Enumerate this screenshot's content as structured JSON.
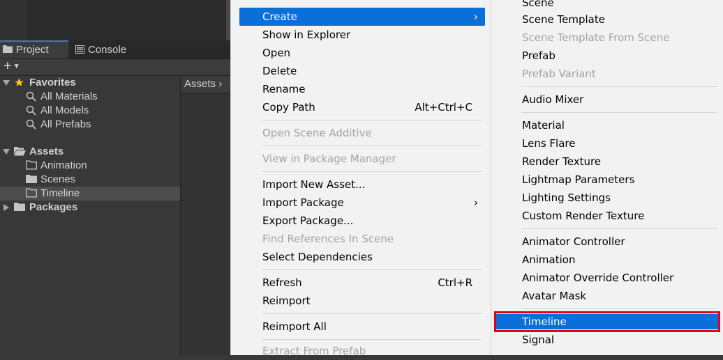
{
  "tabs": {
    "project": "Project",
    "console": "Console"
  },
  "toolbar": {
    "add_label": "+"
  },
  "tree": {
    "favorites": "Favorites",
    "all_materials": "All Materials",
    "all_models": "All Models",
    "all_prefabs": "All Prefabs",
    "assets": "Assets",
    "animation": "Animation",
    "scenes": "Scenes",
    "timeline": "Timeline",
    "packages": "Packages"
  },
  "breadcrumb": {
    "root": "Assets",
    "sep": "›"
  },
  "context_menu": {
    "create": "Create",
    "show_in_explorer": "Show in Explorer",
    "open": "Open",
    "delete": "Delete",
    "rename": "Rename",
    "copy_path": "Copy Path",
    "copy_path_shortcut": "Alt+Ctrl+C",
    "open_scene_additive": "Open Scene Additive",
    "view_in_package_manager": "View in Package Manager",
    "import_new_asset": "Import New Asset...",
    "import_package": "Import Package",
    "export_package": "Export Package...",
    "find_references": "Find References In Scene",
    "select_dependencies": "Select Dependencies",
    "refresh": "Refresh",
    "refresh_shortcut": "Ctrl+R",
    "reimport": "Reimport",
    "reimport_all": "Reimport All",
    "extract_from_prefab": "Extract From Prefab"
  },
  "create_menu": {
    "scene": "Scene",
    "scene_template": "Scene Template",
    "scene_template_from_scene": "Scene Template From Scene",
    "prefab": "Prefab",
    "prefab_variant": "Prefab Variant",
    "audio_mixer": "Audio Mixer",
    "material": "Material",
    "lens_flare": "Lens Flare",
    "render_texture": "Render Texture",
    "lightmap_parameters": "Lightmap Parameters",
    "lighting_settings": "Lighting Settings",
    "custom_render_texture": "Custom Render Texture",
    "animator_controller": "Animator Controller",
    "animation": "Animation",
    "animator_override_controller": "Animator Override Controller",
    "avatar_mask": "Avatar Mask",
    "timeline": "Timeline",
    "signal": "Signal"
  },
  "colors": {
    "highlight": "#0a6fd8",
    "callout": "#e0001b",
    "favorite_star": "#f5c518"
  },
  "icons": [
    "folder-icon",
    "console-icon",
    "star-icon",
    "search-icon",
    "folder-open-icon",
    "chevron-right-icon"
  ]
}
